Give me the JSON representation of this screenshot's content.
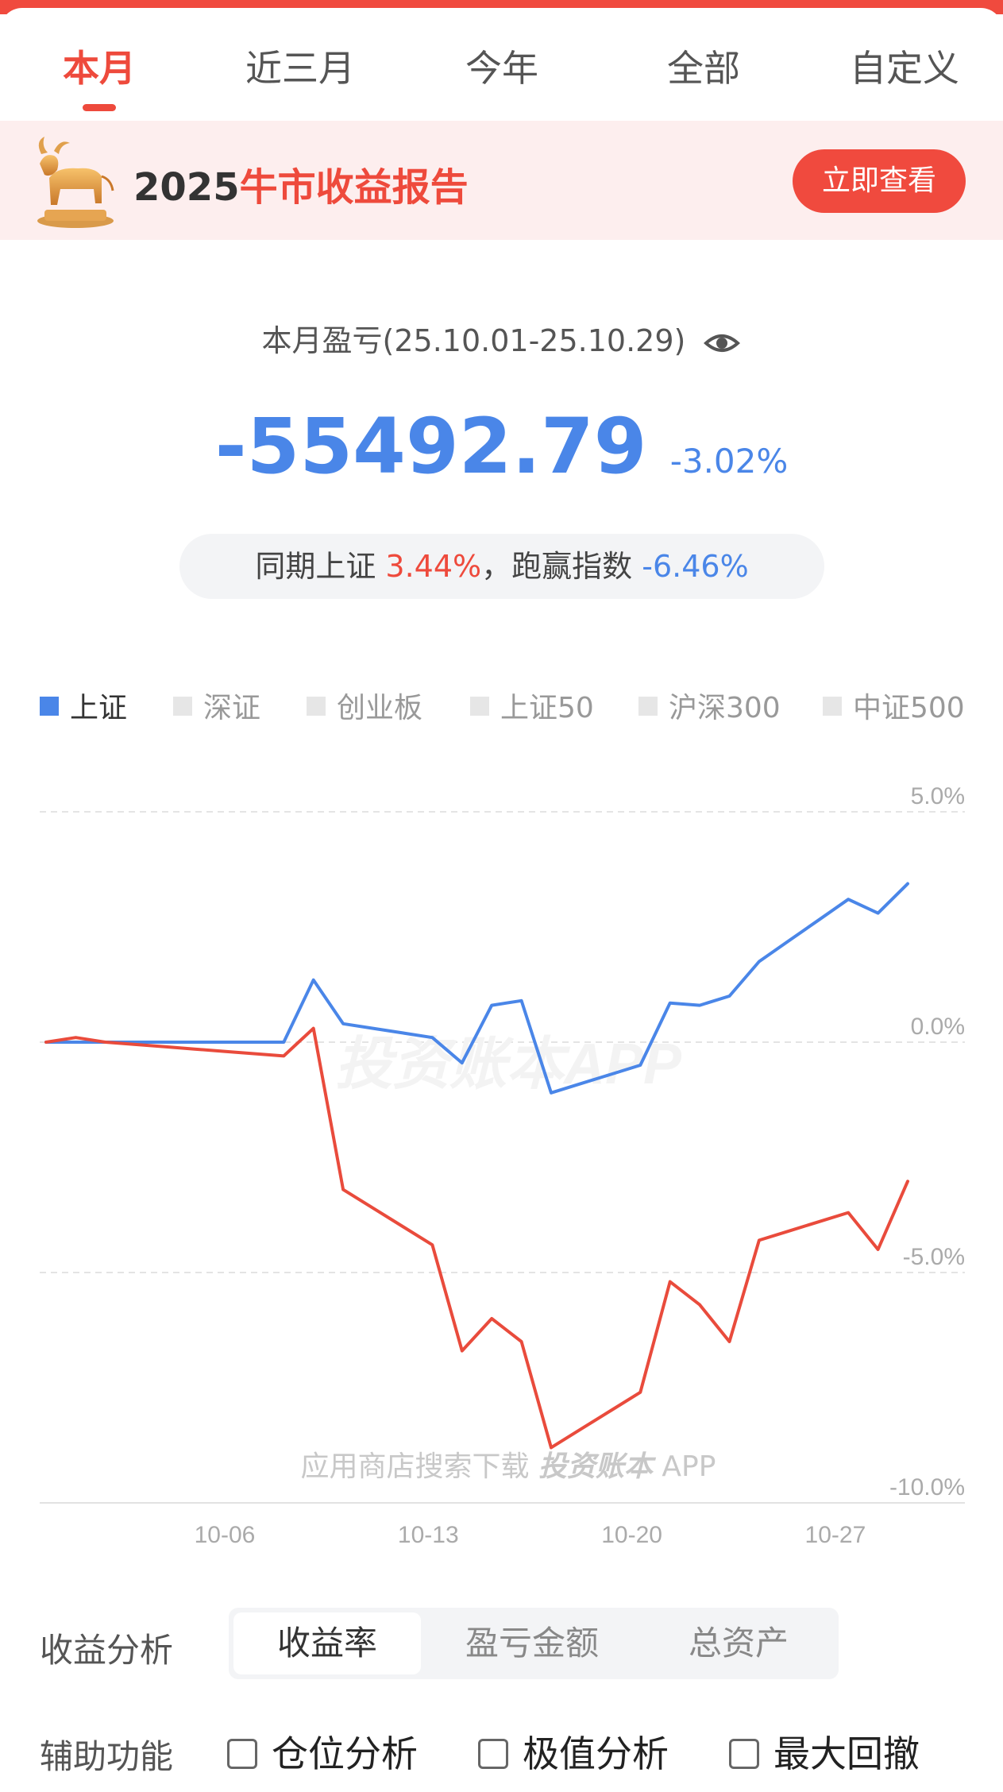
{
  "tabs": [
    {
      "label": "本月",
      "active": true
    },
    {
      "label": "近三月",
      "active": false
    },
    {
      "label": "今年",
      "active": false
    },
    {
      "label": "全部",
      "active": false
    },
    {
      "label": "自定义",
      "active": false
    }
  ],
  "banner": {
    "year": "2025",
    "title_rest": "牛市收益报告",
    "button_label": "立即查看"
  },
  "summary": {
    "period_label": "本月盈亏(25.10.01-25.10.29)",
    "pnl_value": "-55492.79",
    "pnl_pct": "-3.02%",
    "compare_prefix": "同期上证",
    "index_pct": "3.44%",
    "compare_mid": "，跑赢指数",
    "excess_pct": "-6.46%"
  },
  "legend": [
    {
      "label": "上证",
      "active": true
    },
    {
      "label": "深证",
      "active": false
    },
    {
      "label": "创业板",
      "active": false
    },
    {
      "label": "上证50",
      "active": false
    },
    {
      "label": "沪深300",
      "active": false
    },
    {
      "label": "中证500",
      "active": false
    }
  ],
  "chart_data": {
    "type": "line",
    "y_ticks": [
      "5.0%",
      "0.0%",
      "-5.0%",
      "-10.0%"
    ],
    "ylim": [
      -10,
      5
    ],
    "x_ticks": [
      "10-06",
      "10-13",
      "10-20",
      "10-27"
    ],
    "x": [
      "10-01",
      "10-03",
      "10-04",
      "10-05",
      "10-06",
      "10-07",
      "10-08",
      "10-09",
      "10-10",
      "10-11",
      "10-12",
      "10-13",
      "10-14",
      "10-15",
      "10-16",
      "10-17",
      "10-18",
      "10-19",
      "10-20",
      "10-21",
      "10-22",
      "10-23",
      "10-24",
      "10-25",
      "10-26",
      "10-27",
      "10-28",
      "10-29"
    ],
    "series": [
      {
        "color": "#4a86e8",
        "values": [
          0,
          0,
          0,
          0,
          0,
          0,
          0,
          0,
          0,
          1.35,
          0.4,
          0.3,
          0.2,
          0.1,
          -0.45,
          0.8,
          0.9,
          -1.1,
          -0.9,
          -0.7,
          -0.5,
          0.85,
          0.8,
          1.0,
          1.75,
          2.2,
          2.65,
          3.1,
          2.8,
          3.44
        ]
      },
      {
        "color": "#e94b3c",
        "values": [
          0,
          0.1,
          0,
          -0.05,
          -0.1,
          -0.15,
          -0.2,
          -0.25,
          -0.3,
          0.3,
          -3.2,
          -3.6,
          -4.0,
          -4.4,
          -6.7,
          -6.0,
          -6.5,
          -8.8,
          -8.4,
          -8.0,
          -7.6,
          -5.2,
          -5.7,
          -6.5,
          -4.3,
          -4.1,
          -3.9,
          -3.7,
          -4.5,
          -3.02
        ]
      }
    ],
    "watermark": "投资账本APP",
    "footer_text": "应用商店搜索下载",
    "footer_brand": "投资账本",
    "footer_app": "APP"
  },
  "analysis": {
    "label": "收益分析",
    "options": [
      {
        "label": "收益率",
        "active": true
      },
      {
        "label": "盈亏金额",
        "active": false
      },
      {
        "label": "总资产",
        "active": false
      }
    ]
  },
  "aux": {
    "label": "辅助功能",
    "options": [
      {
        "label": "仓位分析",
        "checked": false
      },
      {
        "label": "极值分析",
        "checked": false
      },
      {
        "label": "最大回撤",
        "checked": false
      }
    ]
  }
}
